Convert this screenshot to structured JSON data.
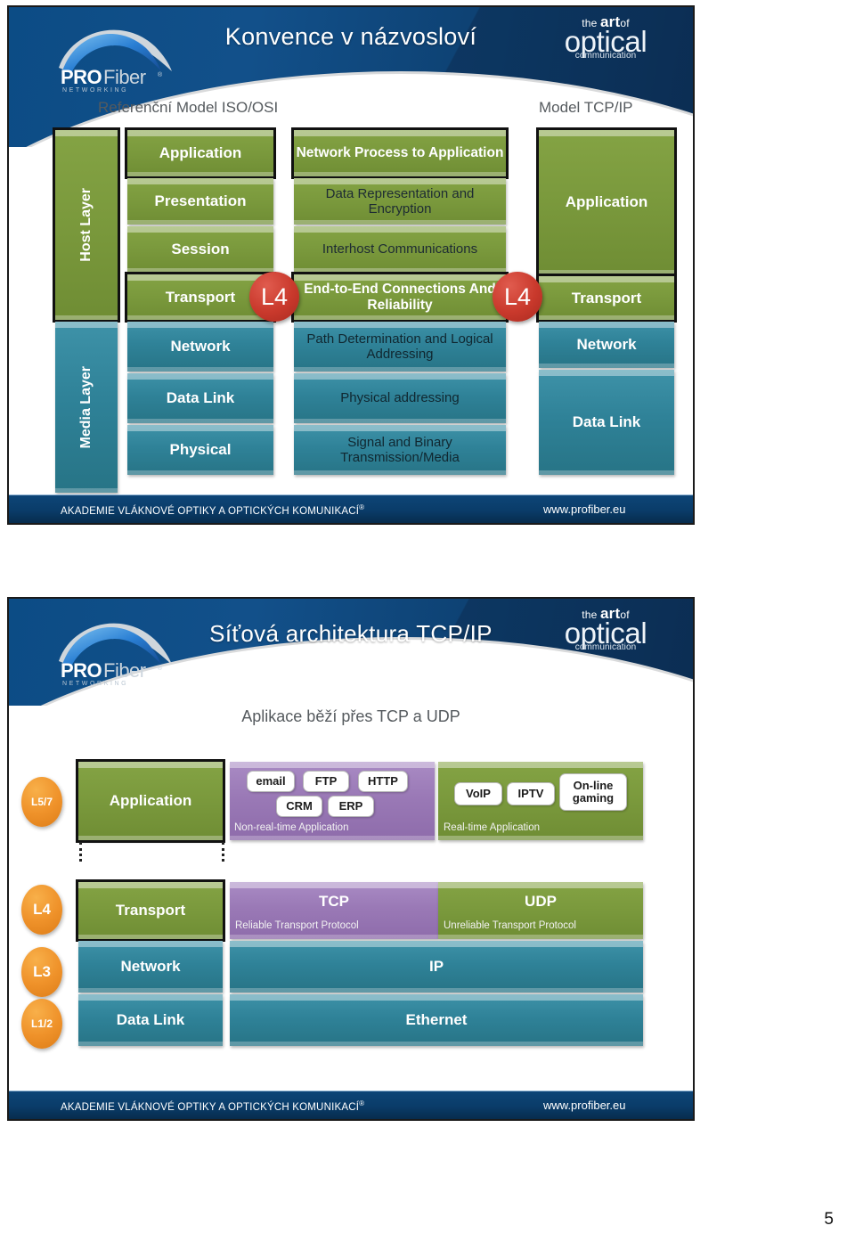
{
  "page": {
    "number": "5"
  },
  "brand": {
    "logo_main": "PROFiber",
    "logo_pro": "PRO",
    "logo_fiber": "Fiber",
    "logo_reg": "®",
    "logo_sub": "N E T W O R K I N G",
    "art_the": "the",
    "art_art": "art",
    "art_of": "of",
    "art_optical": "optical",
    "art_communication": "communication"
  },
  "footer": {
    "left": "AKADEMIE VLÁKNOVÉ OPTIKY  A OPTICKÝCH KOMUNIKACÍ",
    "left_reg": "®",
    "right": "www.profiber.eu"
  },
  "colors": {
    "banner_blue": "#0c4c85",
    "footer_blue": "#0a3c69",
    "green": "#7b9a3d",
    "teal": "#2f8298",
    "purple": "#9a79b6",
    "orange": "#ef922a",
    "red": "#c9392c"
  },
  "slide1": {
    "title": "Konvence v názvosloví",
    "subtitle_left": "Referenční Model ISO/OSI",
    "subtitle_right": "Model TCP/IP",
    "groups": [
      {
        "label": "Host Layer",
        "color": "green"
      },
      {
        "label": "Media Layer",
        "color": "teal"
      }
    ],
    "osi_layers": [
      {
        "name": "Application",
        "color": "green",
        "highlight": false
      },
      {
        "name": "Presentation",
        "color": "green",
        "highlight": false
      },
      {
        "name": "Session",
        "color": "green",
        "highlight": false
      },
      {
        "name": "Transport",
        "color": "green",
        "highlight": true
      },
      {
        "name": "Network",
        "color": "teal",
        "highlight": false
      },
      {
        "name": "Data Link",
        "color": "teal",
        "highlight": false
      },
      {
        "name": "Physical",
        "color": "teal",
        "highlight": false
      }
    ],
    "osi_functions": [
      {
        "text": "Network Process to Application",
        "color": "green",
        "bold": true,
        "highlight": true
      },
      {
        "text": "Data Representation and Encryption",
        "color": "green",
        "bold": false,
        "highlight": false
      },
      {
        "text": "Interhost Communications",
        "color": "green",
        "bold": false,
        "highlight": false
      },
      {
        "text": "End-to-End Connections And Reliability",
        "color": "green",
        "bold": true,
        "highlight": true
      },
      {
        "text": "Path Determination and Logical Addressing",
        "color": "teal",
        "bold": false,
        "highlight": false
      },
      {
        "text": "Physical addressing",
        "color": "teal",
        "bold": false,
        "highlight": false
      },
      {
        "text": "Signal and Binary Transmission/Media",
        "color": "teal",
        "bold": false,
        "highlight": false
      }
    ],
    "tcpip_layers": [
      {
        "name": "Application",
        "color": "green",
        "highlight": true
      },
      {
        "name": "Transport",
        "color": "green",
        "highlight": true
      },
      {
        "name": "Network",
        "color": "teal",
        "highlight": false
      },
      {
        "name": "Data Link",
        "color": "teal",
        "highlight": false
      }
    ],
    "markers": [
      {
        "label": "L4",
        "side": "osi-transport"
      },
      {
        "label": "L4",
        "side": "tcpip-transport"
      }
    ]
  },
  "slide2": {
    "title": "Síťová architektura TCP/IP",
    "subtitle": "Aplikace běží přes TCP a UDP",
    "rows": [
      {
        "badge": "L5/7",
        "layer": "Application",
        "layer_color": "green",
        "blocks": [
          {
            "color": "purple",
            "caption": "Non-real-time Application",
            "tags": [
              "email",
              "FTP",
              "HTTP",
              "CRM",
              "ERP"
            ]
          },
          {
            "color": "green",
            "caption": "Real-time Application",
            "tags": [
              "VoIP",
              "IPTV",
              "On-line gaming"
            ]
          }
        ]
      },
      {
        "badge": "L4",
        "layer": "Transport",
        "layer_color": "green",
        "blocks": [
          {
            "color": "purple",
            "title": "TCP",
            "caption": "Reliable Transport Protocol"
          },
          {
            "color": "green",
            "title": "UDP",
            "caption": "Unreliable Transport Protocol"
          }
        ]
      },
      {
        "badge": "L3",
        "layer": "Network",
        "layer_color": "teal",
        "blocks": [
          {
            "color": "teal",
            "title": "IP",
            "caption": ""
          }
        ]
      },
      {
        "badge": "L1/2",
        "layer": "Data Link",
        "layer_color": "teal",
        "blocks": [
          {
            "color": "teal",
            "title": "Ethernet",
            "caption": ""
          }
        ]
      }
    ]
  }
}
